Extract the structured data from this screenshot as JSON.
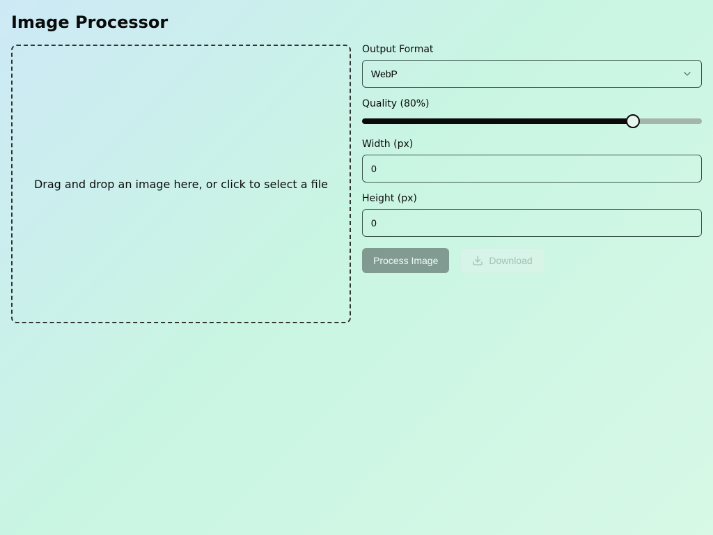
{
  "title": "Image Processor",
  "dropzone": {
    "prompt": "Drag and drop an image here, or click to select a file"
  },
  "controls": {
    "format": {
      "label": "Output Format",
      "selected": "WebP"
    },
    "quality": {
      "label": "Quality (80%)",
      "value": 80,
      "min": 1,
      "max": 100
    },
    "width": {
      "label": "Width (px)",
      "value": "0"
    },
    "height": {
      "label": "Height (px)",
      "value": "0"
    }
  },
  "buttons": {
    "process": "Process Image",
    "download": "Download"
  }
}
